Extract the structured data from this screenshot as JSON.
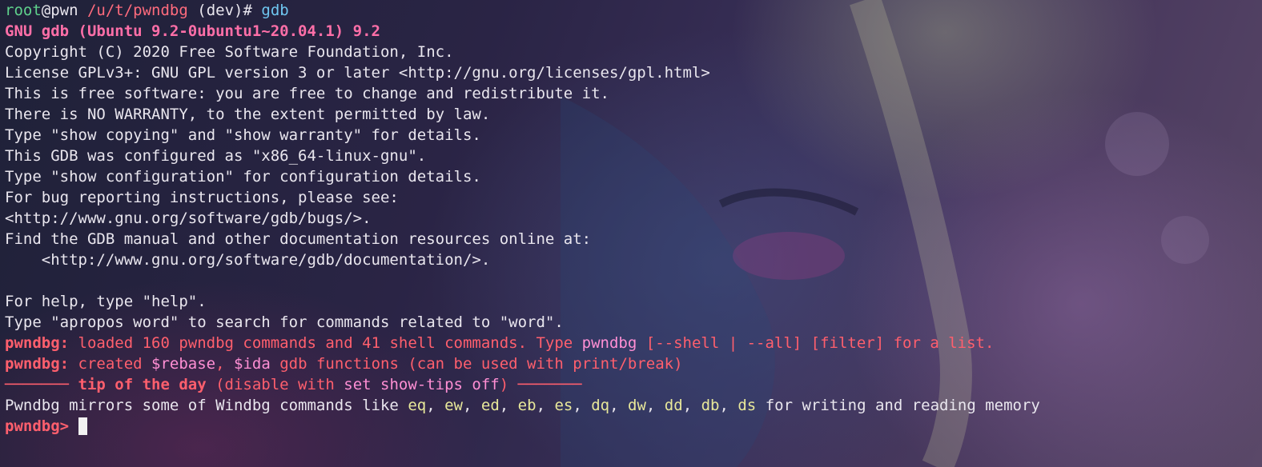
{
  "prompt": {
    "user": "root",
    "host": "@pwn",
    "path": "/u/t/pwndbg",
    "branch": "(dev)#",
    "command": "gdb"
  },
  "banner": {
    "version": "GNU gdb (Ubuntu 9.2-0ubuntu1~20.04.1) 9.2",
    "lines": [
      "Copyright (C) 2020 Free Software Foundation, Inc.",
      "License GPLv3+: GNU GPL version 3 or later <http://gnu.org/licenses/gpl.html>",
      "This is free software: you are free to change and redistribute it.",
      "There is NO WARRANTY, to the extent permitted by law.",
      "Type \"show copying\" and \"show warranty\" for details.",
      "This GDB was configured as \"x86_64-linux-gnu\".",
      "Type \"show configuration\" for configuration details.",
      "For bug reporting instructions, please see:",
      "<http://www.gnu.org/software/gdb/bugs/>.",
      "Find the GDB manual and other documentation resources online at:",
      "    <http://www.gnu.org/software/gdb/documentation/>.",
      "",
      "For help, type \"help\".",
      "Type \"apropos word\" to search for commands related to \"word\"."
    ]
  },
  "pwndbg": {
    "label": "pwndbg:",
    "loaded": {
      "a": " loaded 160 pwndbg commands and 41 shell commands. Type ",
      "b": "pwndbg",
      "c": " [--shell | --all] [filter] for a list."
    },
    "created": {
      "a": " created ",
      "b": "$rebase",
      "c": ", ",
      "d": "$ida",
      "e": " gdb functions (can be used with print/break)"
    },
    "tip": {
      "dash_left": "─────── ",
      "title": "tip of the day",
      "p1": " (disable with ",
      "cmd": "set show-tips off",
      "p2": ") ",
      "dash_right": "───────"
    },
    "mirrors": {
      "prefix": "Pwndbg mirrors some of Windbg commands like ",
      "commands": [
        "eq",
        "ew",
        "ed",
        "eb",
        "es",
        "dq",
        "dw",
        "dd",
        "db",
        "ds"
      ],
      "sep": ", ",
      "suffix": " for writing and reading memory"
    },
    "prompt": "pwndbg> "
  }
}
